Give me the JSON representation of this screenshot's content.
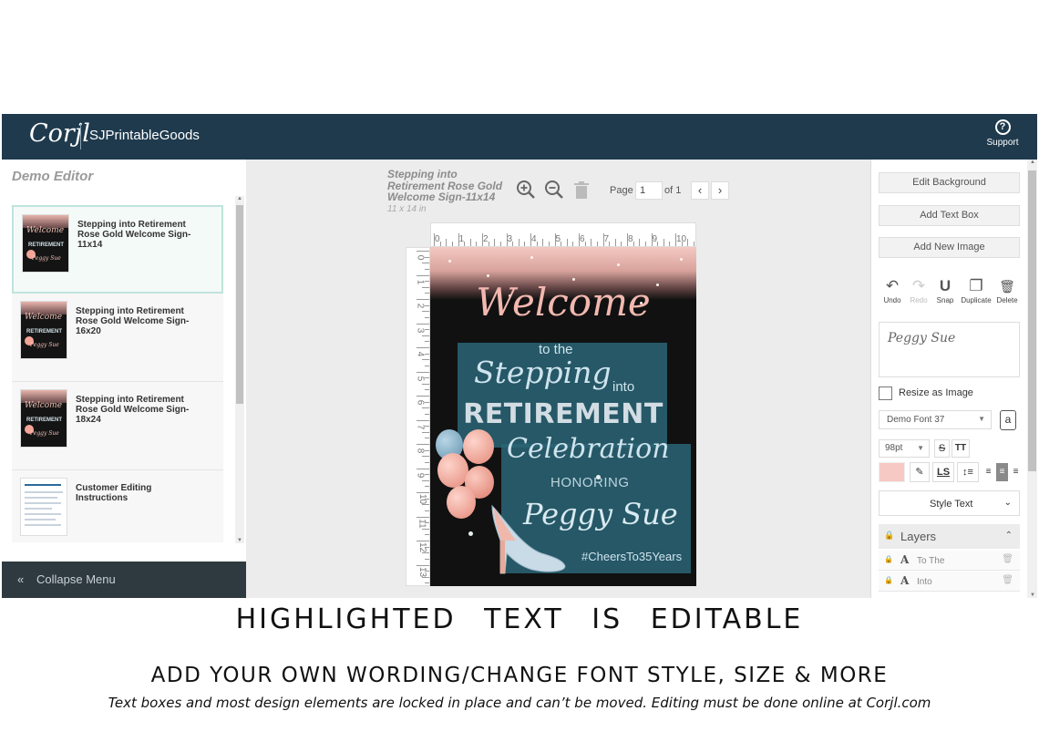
{
  "header": {
    "logo": "Corjl",
    "brand": "SJPrintableGoods",
    "support_label": "Support"
  },
  "left_panel": {
    "title": "Demo Editor",
    "templates": [
      {
        "name": "Stepping into Retirement Rose Gold Welcome Sign-11x14",
        "selected": true
      },
      {
        "name": "Stepping into Retirement Rose Gold Welcome Sign-16x20",
        "selected": false
      },
      {
        "name": "Stepping into Retirement Rose Gold Welcome Sign-18x24",
        "selected": false
      },
      {
        "name": "Customer Editing Instructions",
        "selected": false
      }
    ],
    "collapse_label": "Collapse Menu"
  },
  "document": {
    "title": "Stepping into Retirement Rose Gold Welcome Sign-11x14",
    "size": "11 x 14 in",
    "page_label": "Page",
    "page_value": "1",
    "page_of": "of 1",
    "ruler_h": [
      "0",
      "1",
      "2",
      "3",
      "4",
      "5",
      "6",
      "7",
      "8",
      "9",
      "10"
    ],
    "ruler_v": [
      "0",
      "1",
      "2",
      "3",
      "4",
      "5",
      "6",
      "7",
      "8",
      "9",
      "10",
      "11",
      "12",
      "13"
    ]
  },
  "sign": {
    "welcome": "Welcome",
    "to_the": "to the",
    "stepping": "Stepping",
    "into": "into",
    "retirement": "RETIREMENT",
    "celebration": "Celebration",
    "honoring": "HONORING",
    "name": "Peggy Sue",
    "hashtag": "#CheersTo35Years"
  },
  "right_panel": {
    "edit_background": "Edit Background",
    "add_text_box": "Add Text Box",
    "add_new_image": "Add New Image",
    "tools": [
      {
        "label": "Undo",
        "icon": "undo-icon",
        "glyph": "↶",
        "enabled": true
      },
      {
        "label": "Redo",
        "icon": "redo-icon",
        "glyph": "↷",
        "enabled": false
      },
      {
        "label": "Snap",
        "icon": "magnet-icon",
        "glyph": "U",
        "enabled": true
      },
      {
        "label": "Duplicate",
        "icon": "duplicate-icon",
        "glyph": "❐",
        "enabled": true
      },
      {
        "label": "Delete",
        "icon": "trash-icon",
        "glyph": "🗑",
        "enabled": true
      }
    ],
    "preview_text": "Peggy Sue",
    "resize_label": "Resize as Image",
    "font_name": "Demo Font 37",
    "font_size": "98pt",
    "style_text": "Style Text",
    "layers_label": "Layers",
    "layers": [
      {
        "name": "To The"
      },
      {
        "name": "Into"
      }
    ],
    "text_color": "#f7c9c4"
  },
  "captions": {
    "headline": "HIGHLIGHTED TEXT IS EDITABLE",
    "subhead": "ADD YOUR OWN WORDING/CHANGE FONT STYLE, SIZE & MORE",
    "note": "Text boxes and most design elements are locked in place and can’t be moved. Editing must be done online at Corjl.com"
  }
}
